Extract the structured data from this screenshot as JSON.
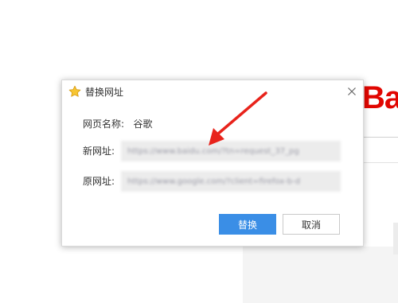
{
  "background": {
    "logo_text": "Ba"
  },
  "dialog": {
    "title": "替换网址",
    "title_icon": "star-icon",
    "close_icon": "close-icon",
    "page_name_label": "网页名称:",
    "page_name_value": "谷歌",
    "new_url_label": "新网址:",
    "new_url_value": "https://www.baidu.com/?tn=request_37_pg",
    "original_url_label": "原网址:",
    "original_url_value": "https://www.google.com/?client=firefox-b-d",
    "replace_button": "替换",
    "cancel_button": "取消"
  },
  "colors": {
    "accent": "#3a8ee6",
    "brand_red": "#e10601",
    "arrow_red": "#e8231b",
    "star_yellow": "#f7c531"
  }
}
